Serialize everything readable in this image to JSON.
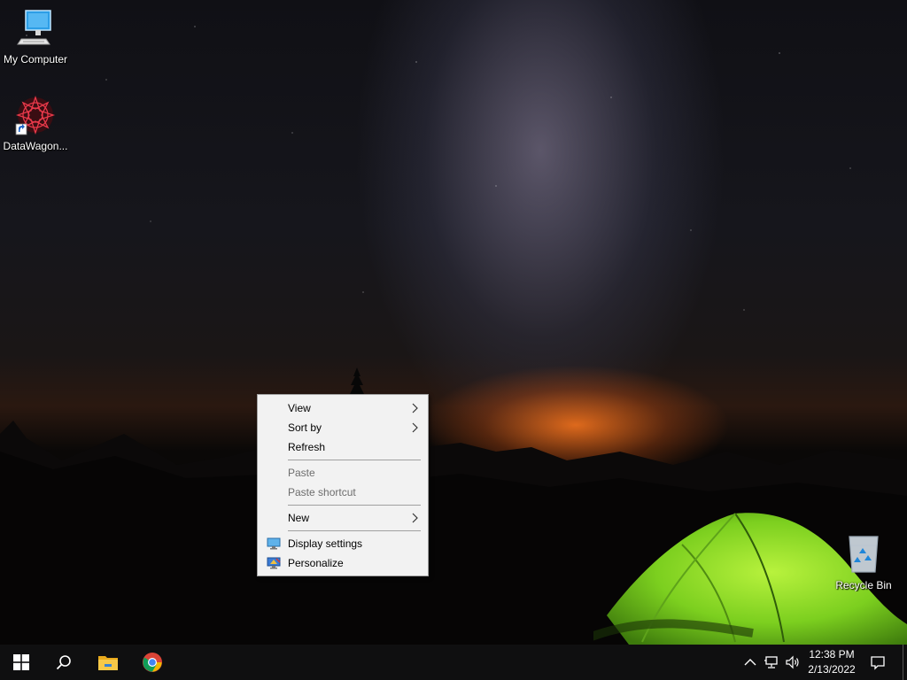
{
  "desktop": {
    "icons": [
      {
        "label": "My Computer",
        "icon": "monitor-icon"
      },
      {
        "label": "DataWagon...",
        "icon": "datawagon-shortcut-icon"
      },
      {
        "label": "Recycle Bin",
        "icon": "recycle-bin-icon"
      }
    ]
  },
  "context_menu": {
    "items": [
      {
        "label": "View",
        "has_submenu": true,
        "disabled": false
      },
      {
        "label": "Sort by",
        "has_submenu": true,
        "disabled": false
      },
      {
        "label": "Refresh",
        "has_submenu": false,
        "disabled": false
      },
      {
        "label": "Paste",
        "has_submenu": false,
        "disabled": true
      },
      {
        "label": "Paste shortcut",
        "has_submenu": false,
        "disabled": true
      },
      {
        "label": "New",
        "has_submenu": true,
        "disabled": false
      },
      {
        "label": "Display settings",
        "icon": "display-settings-icon",
        "disabled": false
      },
      {
        "label": "Personalize",
        "icon": "personalize-icon",
        "disabled": false
      }
    ]
  },
  "taskbar": {
    "start_icon": "windows-start-icon",
    "search_icon": "search-icon",
    "pinned": [
      {
        "name": "File Explorer",
        "icon": "file-explorer-icon"
      },
      {
        "name": "Google Chrome",
        "icon": "chrome-icon"
      }
    ],
    "tray": {
      "icons": [
        "chevron-up-icon",
        "network-icon",
        "volume-icon"
      ],
      "time": "12:38 PM",
      "date": "2/13/2022",
      "notification_icon": "notification-icon"
    }
  },
  "colors": {
    "menu_bg": "#f2f2f2",
    "menu_disabled_text": "#6d6d6d",
    "taskbar_bg": "#0f0f10",
    "tent_green": "#8fdc2a"
  }
}
